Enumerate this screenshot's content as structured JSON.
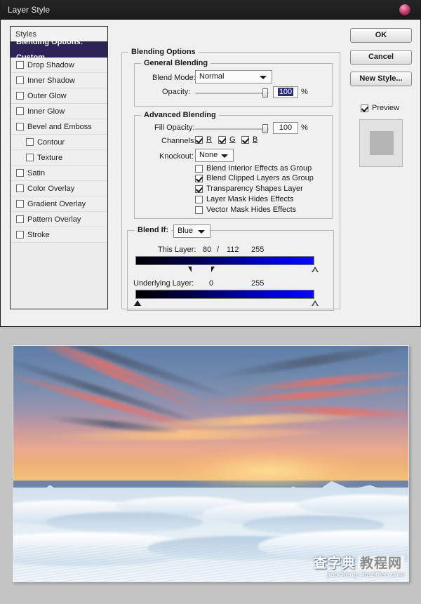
{
  "window": {
    "title": "Layer Style",
    "close_icon": "photoshop-orb-icon"
  },
  "styles_panel": {
    "header": "Styles",
    "items": [
      {
        "label": "Blending Options: Custom",
        "checked": null,
        "selected": true,
        "sub": false
      },
      {
        "label": "Drop Shadow",
        "checked": false,
        "selected": false,
        "sub": false
      },
      {
        "label": "Inner Shadow",
        "checked": false,
        "selected": false,
        "sub": false
      },
      {
        "label": "Outer Glow",
        "checked": false,
        "selected": false,
        "sub": false
      },
      {
        "label": "Inner Glow",
        "checked": false,
        "selected": false,
        "sub": false
      },
      {
        "label": "Bevel and Emboss",
        "checked": false,
        "selected": false,
        "sub": false
      },
      {
        "label": "Contour",
        "checked": false,
        "selected": false,
        "sub": true
      },
      {
        "label": "Texture",
        "checked": false,
        "selected": false,
        "sub": true
      },
      {
        "label": "Satin",
        "checked": false,
        "selected": false,
        "sub": false
      },
      {
        "label": "Color Overlay",
        "checked": false,
        "selected": false,
        "sub": false
      },
      {
        "label": "Gradient Overlay",
        "checked": false,
        "selected": false,
        "sub": false
      },
      {
        "label": "Pattern Overlay",
        "checked": false,
        "selected": false,
        "sub": false
      },
      {
        "label": "Stroke",
        "checked": false,
        "selected": false,
        "sub": false
      }
    ],
    "selection_color": "#2d2357"
  },
  "blending": {
    "group_label": "Blending Options",
    "general": {
      "group_label": "General Blending",
      "blend_mode_label": "Blend Mode:",
      "blend_mode_value": "Normal",
      "opacity_label": "Opacity:",
      "opacity_value": "100",
      "opacity_unit": "%"
    },
    "advanced": {
      "group_label": "Advanced Blending",
      "fill_opacity_label": "Fill Opacity:",
      "fill_opacity_value": "100",
      "fill_opacity_unit": "%",
      "channels_label": "Channels:",
      "channels": [
        {
          "label": "R",
          "checked": true
        },
        {
          "label": "G",
          "checked": true
        },
        {
          "label": "B",
          "checked": true
        }
      ],
      "knockout_label": "Knockout:",
      "knockout_value": "None",
      "checkboxes": [
        {
          "label": "Blend Interior Effects as Group",
          "checked": false
        },
        {
          "label": "Blend Clipped Layers as Group",
          "checked": true
        },
        {
          "label": "Transparency Shapes Layer",
          "checked": true
        },
        {
          "label": "Layer Mask Hides Effects",
          "checked": false
        },
        {
          "label": "Vector Mask Hides Effects",
          "checked": false
        }
      ]
    },
    "blend_if": {
      "group_label": "Blend If:",
      "channel_value": "Blue",
      "this_layer": {
        "label": "This Layer:",
        "low_left": "80",
        "separator": "/",
        "low_right": "112",
        "high": "255"
      },
      "underlying_layer": {
        "label": "Underlying Layer:",
        "low": "0",
        "high": "255"
      }
    }
  },
  "buttons": {
    "ok": "OK",
    "cancel": "Cancel",
    "new_style": "New Style...",
    "preview_label": "Preview",
    "preview_checked": true
  },
  "photo": {
    "description": "Sunset sky with pink and orange clouds over a snow covered dune landscape with mountains"
  },
  "watermark": {
    "cn_left": "查字典",
    "cn_boxed": "教程网",
    "url": "jiaocheng.chazidian.com"
  }
}
